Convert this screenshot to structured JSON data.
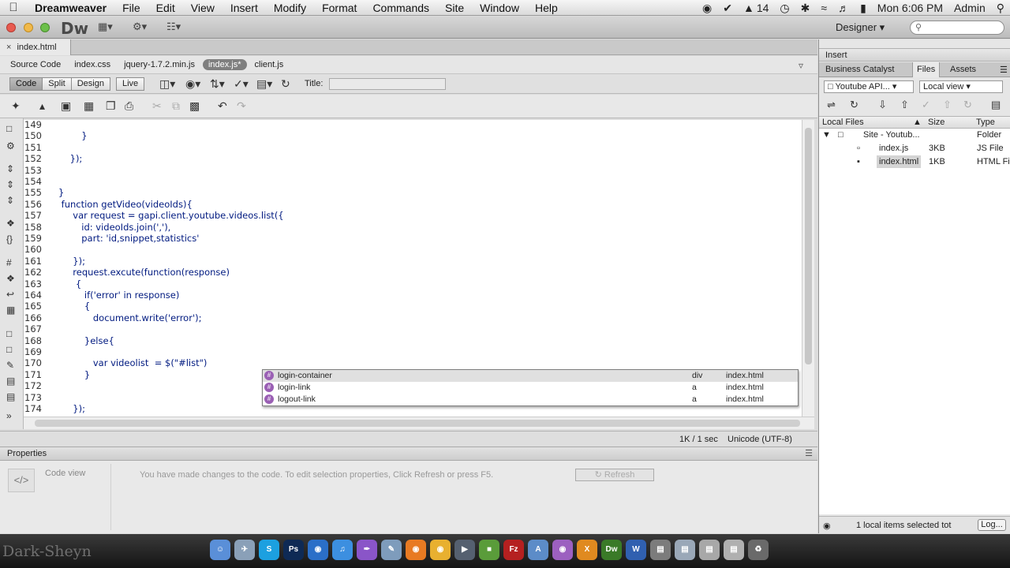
{
  "menubar": {
    "app": "Dreamweaver",
    "items": [
      "File",
      "Edit",
      "View",
      "Insert",
      "Modify",
      "Format",
      "Commands",
      "Site",
      "Window",
      "Help"
    ],
    "status_text": "14",
    "clock": "Mon 6:06 PM",
    "user": "Admin"
  },
  "appbar": {
    "logo": "Dw",
    "workspace": "Designer"
  },
  "document_tab": "index.html",
  "related_files": [
    "Source Code",
    "index.css",
    "jquery-1.7.2.min.js",
    "index.js*",
    "client.js"
  ],
  "active_related": "index.js*",
  "view_buttons": [
    "Code",
    "Split",
    "Design",
    "Live"
  ],
  "title_label": "Title:",
  "code_lines": [
    {
      "n": "149",
      "t": ""
    },
    {
      "n": "150",
      "t": "        }"
    },
    {
      "n": "151",
      "t": ""
    },
    {
      "n": "152",
      "t": "    });"
    },
    {
      "n": "153",
      "t": ""
    },
    {
      "n": "154",
      "t": ""
    },
    {
      "n": "155",
      "t": "}"
    },
    {
      "n": "156",
      "t": " function getVideo(videoIds){"
    },
    {
      "n": "157",
      "t": "     var request = gapi.client.youtube.videos.list({"
    },
    {
      "n": "158",
      "t": "        id: videoIds.join(','),"
    },
    {
      "n": "159",
      "t": "        part: 'id,snippet,statistics'"
    },
    {
      "n": "160",
      "t": ""
    },
    {
      "n": "161",
      "t": "     });"
    },
    {
      "n": "162",
      "t": "     request.excute(function(response)"
    },
    {
      "n": "163",
      "t": "      {"
    },
    {
      "n": "164",
      "t": "         if('error' in response)"
    },
    {
      "n": "165",
      "t": "         {"
    },
    {
      "n": "166",
      "t": "            document.write('error');"
    },
    {
      "n": "167",
      "t": ""
    },
    {
      "n": "168",
      "t": "         }else{"
    },
    {
      "n": "169",
      "t": ""
    },
    {
      "n": "170",
      "t": "            var videolist  = $(\"#list\")"
    },
    {
      "n": "171",
      "t": "         }"
    },
    {
      "n": "172",
      "t": ""
    },
    {
      "n": "173",
      "t": ""
    },
    {
      "n": "174",
      "t": "     });"
    }
  ],
  "code_hints": [
    {
      "name": "login-container",
      "tag": "div",
      "file": "index.html"
    },
    {
      "name": "login-link",
      "tag": "a",
      "file": "index.html"
    },
    {
      "name": "logout-link",
      "tag": "a",
      "file": "index.html"
    }
  ],
  "statusbar": {
    "size": "1K / 1 sec",
    "encoding": "Unicode (UTF-8)"
  },
  "properties": {
    "title": "Properties",
    "mode": "Code view",
    "message": "You have made changes to the code. To edit selection properties, Click Refresh or press F5.",
    "refresh": "Refresh"
  },
  "right_panel": {
    "insert": "Insert",
    "tabs": [
      "Business Catalyst",
      "Files",
      "Assets"
    ],
    "active_tab": "Files",
    "site_select": "Youtube API...",
    "view_select": "Local view",
    "columns": [
      "Local Files",
      "Size",
      "Type"
    ],
    "files": [
      {
        "name": "Site - Youtub...",
        "size": "",
        "type": "Folder"
      },
      {
        "name": "index.js",
        "size": "3KB",
        "type": "JS File"
      },
      {
        "name": "index.html",
        "size": "1KB",
        "type": "HTML Fi"
      }
    ],
    "status": "1 local items selected tot",
    "log_button": "Log..."
  },
  "dock": {
    "brand": "Dark-Sheyn"
  },
  "colors": {
    "code_text": "#001a80",
    "string": "#8a2a2a",
    "hint_icon": "#9a5fb4"
  }
}
